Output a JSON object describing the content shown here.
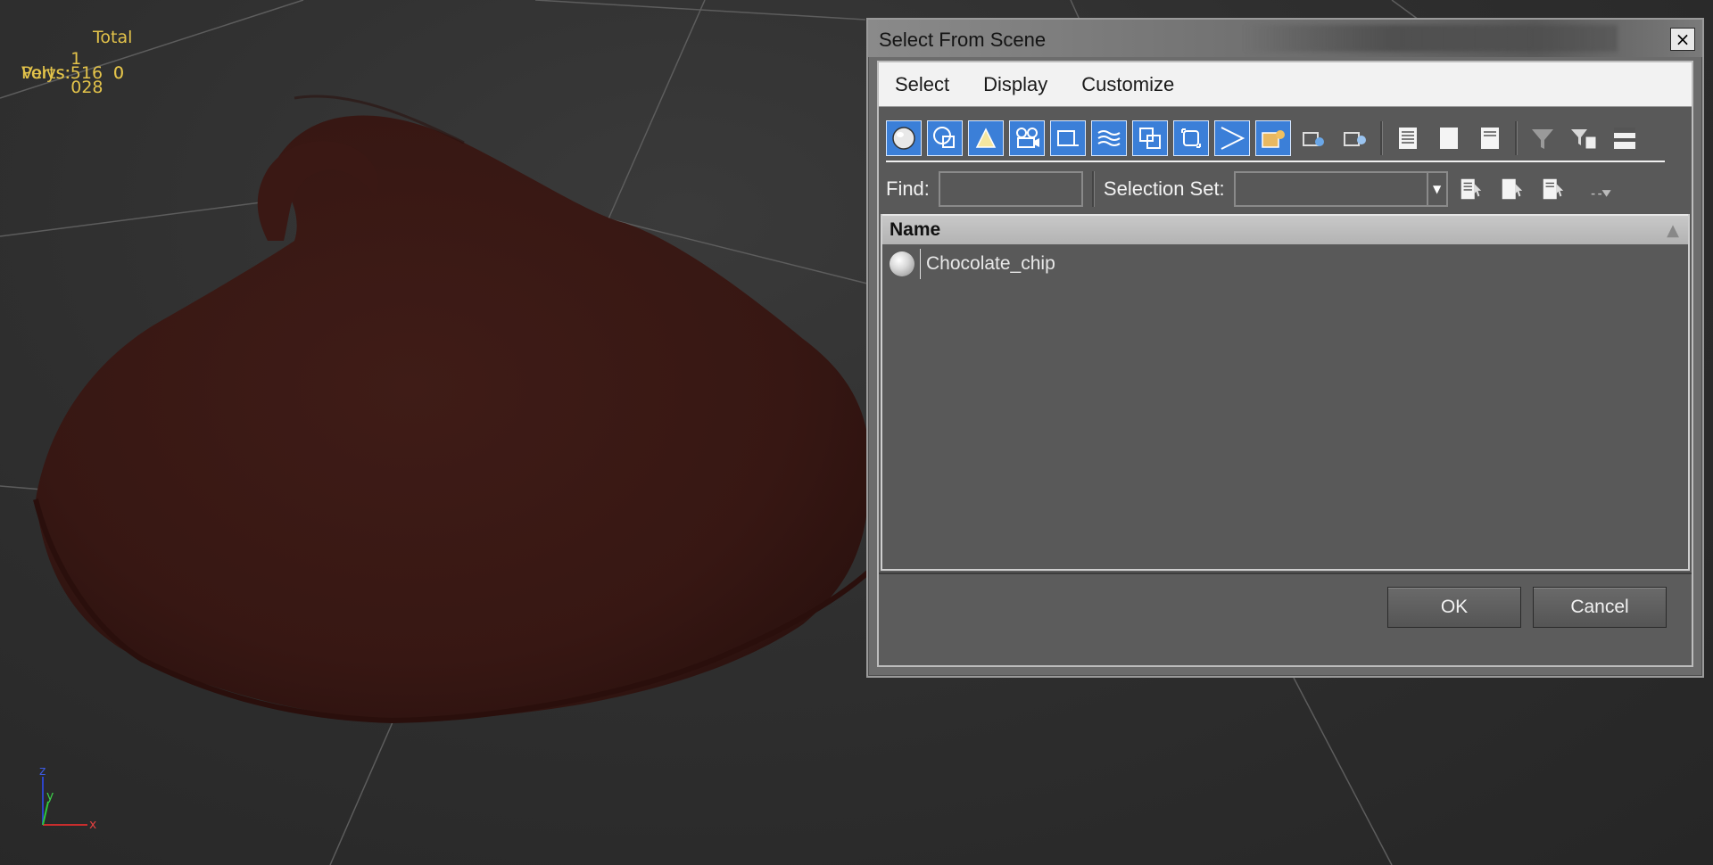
{
  "stats": {
    "header": "Total",
    "polys_label": "Polys:",
    "polys_total": "1 028",
    "polys_selected": "0",
    "verts_label": "Verts:",
    "verts_total": "516",
    "verts_selected": "0"
  },
  "gizmo": {
    "z": "z",
    "y": "y",
    "x": "x"
  },
  "dialog": {
    "title": "Select From Scene",
    "close_label": "×",
    "menu": [
      "Select",
      "Display",
      "Customize"
    ],
    "find_label": "Find:",
    "find_value": "",
    "selection_set_label": "Selection Set:",
    "selection_set_value": "",
    "list_header": "Name",
    "items": [
      {
        "name": "Chocolate_chip",
        "icon": "geometry-sphere-icon"
      }
    ],
    "ok_label": "OK",
    "cancel_label": "Cancel"
  },
  "colors": {
    "stats_text": "#e3c34a",
    "toolbar_active": "#3b7fd8",
    "chip": "#3b1a16"
  }
}
